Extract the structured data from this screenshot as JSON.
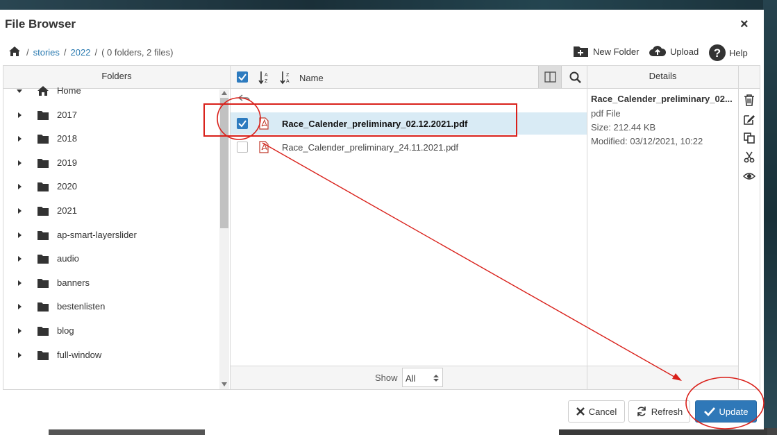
{
  "dialog": {
    "title": "File Browser",
    "close_label": "×"
  },
  "breadcrumb": {
    "separator": "/",
    "items": [
      "stories",
      "2022"
    ],
    "summary": "( 0 folders, 2 files)"
  },
  "toolbar": {
    "new_folder": "New Folder",
    "upload": "Upload",
    "help": "Help"
  },
  "folders": {
    "header": "Folders",
    "items": [
      {
        "label": "Home",
        "type": "home",
        "expanded": true
      },
      {
        "label": "2017",
        "type": "folder"
      },
      {
        "label": "2018",
        "type": "folder"
      },
      {
        "label": "2019",
        "type": "folder"
      },
      {
        "label": "2020",
        "type": "folder"
      },
      {
        "label": "2021",
        "type": "folder"
      },
      {
        "label": "ap-smart-layerslider",
        "type": "folder"
      },
      {
        "label": "audio",
        "type": "folder"
      },
      {
        "label": "banners",
        "type": "folder"
      },
      {
        "label": "bestenlisten",
        "type": "folder"
      },
      {
        "label": "blog",
        "type": "folder"
      },
      {
        "label": "full-window",
        "type": "folder"
      }
    ]
  },
  "files": {
    "name_header": "Name",
    "rows": [
      {
        "name": "Race_Calender_preliminary_02.12.2021.pdf",
        "checked": true,
        "selected": true
      },
      {
        "name": "Race_Calender_preliminary_24.11.2021.pdf",
        "checked": false,
        "selected": false
      }
    ],
    "show_label": "Show",
    "show_value": "All"
  },
  "details": {
    "header": "Details",
    "name": "Race_Calender_preliminary_02...",
    "type": "pdf File",
    "size": "Size: 212.44 KB",
    "modified": "Modified: 03/12/2021, 10:22"
  },
  "footer": {
    "cancel": "Cancel",
    "refresh": "Refresh",
    "update": "Update"
  },
  "colors": {
    "accent": "#2f78b8",
    "annotation": "#d9201a",
    "selected_row": "#d9ebf5"
  },
  "icons": [
    "home-icon",
    "folder-icon",
    "new-folder-icon",
    "upload-icon",
    "help-icon",
    "sort-asc-icon",
    "sort-desc-icon",
    "panel-toggle-icon",
    "search-icon",
    "pdf-icon",
    "trash-icon",
    "edit-icon",
    "copy-icon",
    "cut-icon",
    "preview-icon",
    "close-icon",
    "refresh-icon",
    "check-icon"
  ]
}
